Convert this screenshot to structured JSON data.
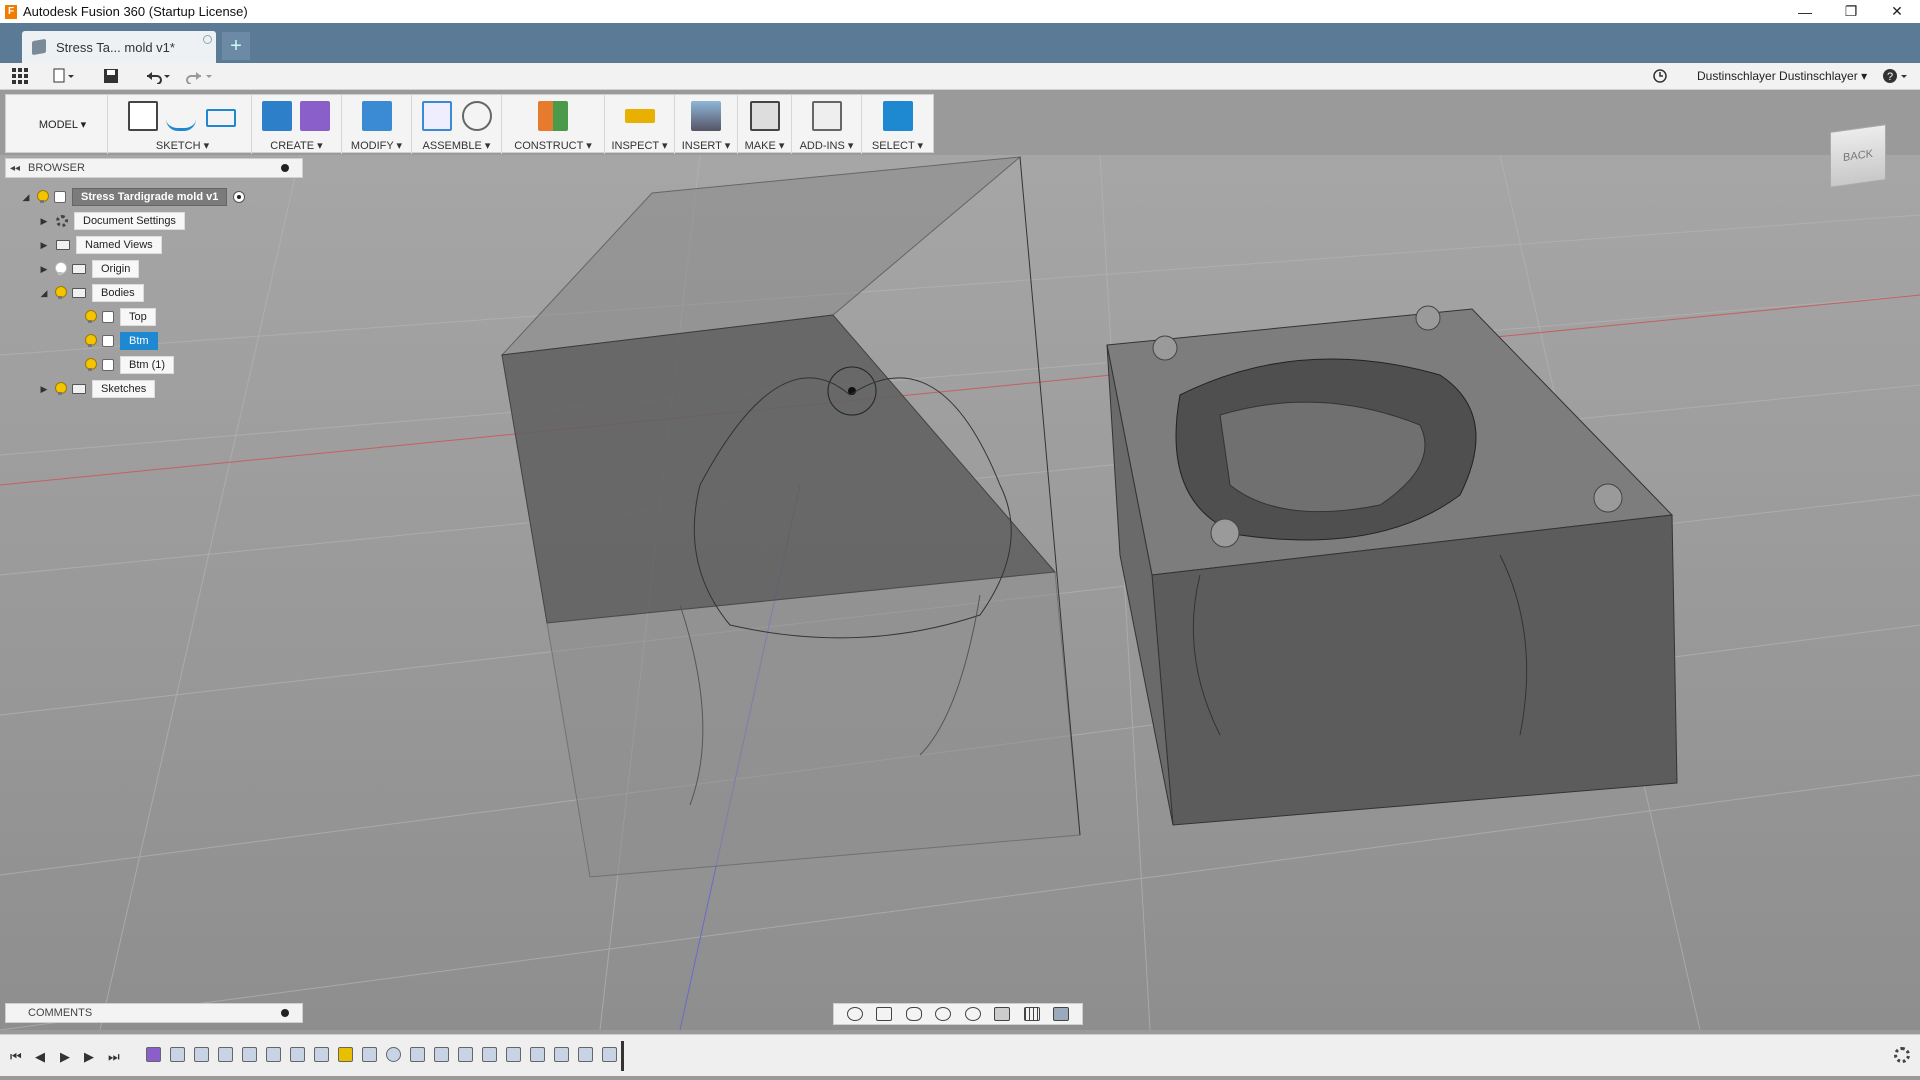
{
  "window": {
    "title": "Autodesk Fusion 360 (Startup License)",
    "controls": {
      "minimize": "—",
      "restore": "❐",
      "close": "✕"
    }
  },
  "tabs": {
    "active_label": "Stress Ta... mold v1*",
    "close": "×",
    "new_tab": "+"
  },
  "quick_access": {
    "user": "Dustinschlayer Dustinschlayer ▾",
    "help": "?"
  },
  "toolbar": {
    "workspace": "MODEL ▾",
    "groups": [
      "SKETCH ▾",
      "CREATE ▾",
      "MODIFY ▾",
      "ASSEMBLE ▾",
      "CONSTRUCT ▾",
      "INSPECT ▾",
      "INSERT ▾",
      "MAKE ▾",
      "ADD-INS ▾",
      "SELECT ▾"
    ]
  },
  "browser": {
    "header": "BROWSER",
    "root": "Stress Tardigrade mold v1",
    "items": [
      {
        "label": "Document Settings"
      },
      {
        "label": "Named Views"
      },
      {
        "label": "Origin"
      },
      {
        "label": "Bodies"
      },
      {
        "label": "Top"
      },
      {
        "label": "Btm"
      },
      {
        "label": "Btm (1)"
      },
      {
        "label": "Sketches"
      }
    ]
  },
  "viewcube": {
    "face": "BACK"
  },
  "comments": {
    "label": "COMMENTS"
  },
  "colors": {
    "tab_bar": "#5b7a96",
    "accent": "#1e88d0",
    "viewport": "#9a9a9a"
  }
}
